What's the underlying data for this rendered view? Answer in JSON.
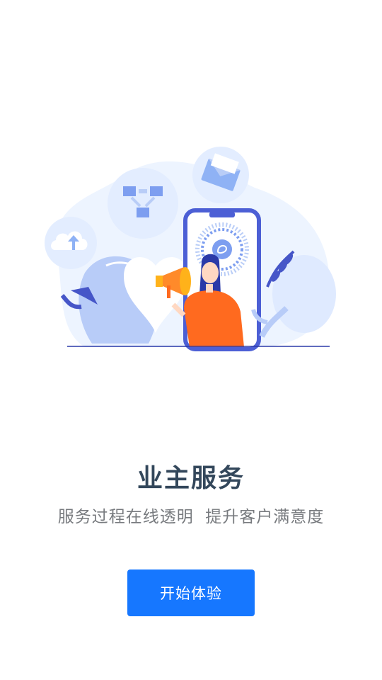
{
  "hero": {
    "title": "业主服务",
    "subtitle": "服务过程在线透明  提升客户满意度"
  },
  "actions": {
    "start_label": "开始体验"
  },
  "colors": {
    "title": "#33475b",
    "subtitle": "#777a7e",
    "button": "#1677ff",
    "illustration_primary": "#4c5fd5",
    "illustration_light": "#e6f0ff",
    "illustration_accent": "#ff6a1f"
  },
  "icons": {
    "illustration_elements": [
      "cloud-upload-icon",
      "flowchart-icon",
      "envelope-icon",
      "phone-icon",
      "qr-code-icon",
      "megaphone-icon",
      "person-figure",
      "leaf-icon"
    ]
  }
}
